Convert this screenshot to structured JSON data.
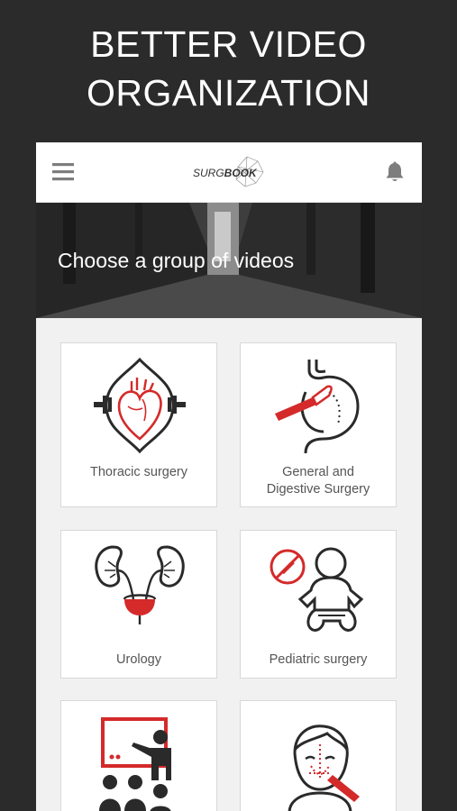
{
  "promo": {
    "headline_line1": "BETTER VIDEO",
    "headline_line2": "ORGANIZATION"
  },
  "appbar": {
    "menu_icon": "hamburger-menu-icon",
    "logo_light": "SURG",
    "logo_bold": "BOOK",
    "bell_icon": "bell-icon"
  },
  "hero": {
    "title": "Choose a group of videos"
  },
  "categories": [
    {
      "label_line1": "Thoracic surgery",
      "label_line2": "",
      "icon": "heart-icon"
    },
    {
      "label_line1": "General and",
      "label_line2": "Digestive Surgery",
      "icon": "stomach-scalpel-icon"
    },
    {
      "label_line1": "Urology",
      "label_line2": "",
      "icon": "kidneys-icon"
    },
    {
      "label_line1": "Pediatric surgery",
      "label_line2": "",
      "icon": "baby-icon"
    },
    {
      "label_line1": "",
      "label_line2": "",
      "icon": "teacher-presentation-icon"
    },
    {
      "label_line1": "",
      "label_line2": "",
      "icon": "face-surgery-icon"
    }
  ],
  "colors": {
    "accent": "#d42a2a",
    "line": "#2a2a2a",
    "background": "#2b2b2b"
  }
}
